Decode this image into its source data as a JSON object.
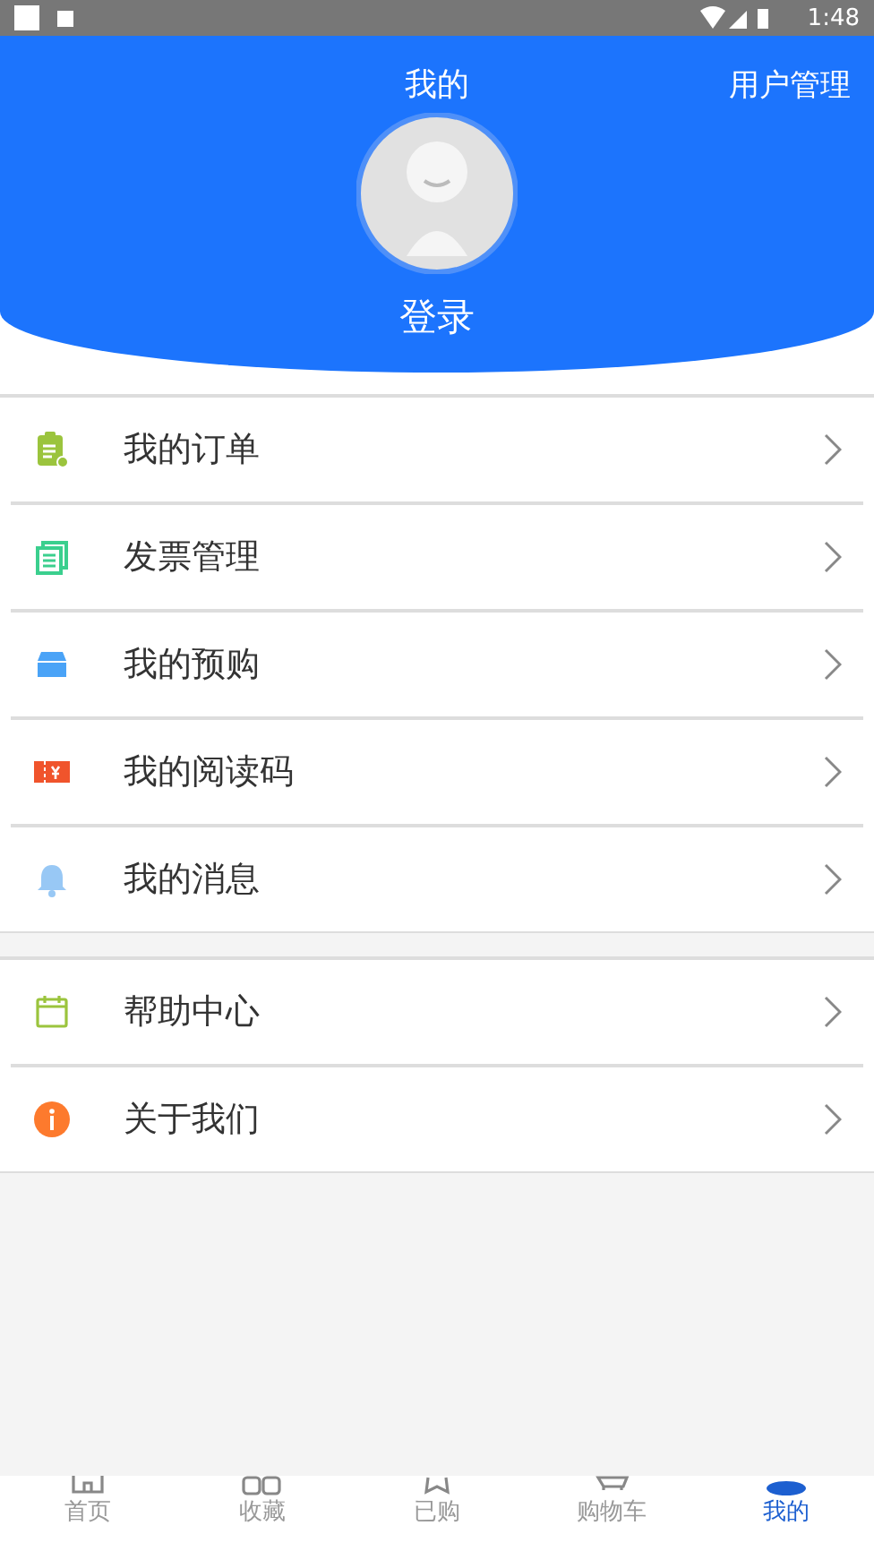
{
  "status_bar": {
    "time": "1:48"
  },
  "header": {
    "title": "我的",
    "action": "用户管理",
    "login": "登录"
  },
  "menu_groups": [
    {
      "items": [
        {
          "kind": "order",
          "label": "我的订单"
        },
        {
          "kind": "invoice",
          "label": "发票管理"
        },
        {
          "kind": "preorder",
          "label": "我的预购"
        },
        {
          "kind": "code",
          "label": "我的阅读码"
        },
        {
          "kind": "message",
          "label": "我的消息"
        }
      ]
    },
    {
      "items": [
        {
          "kind": "help",
          "label": "帮助中心"
        },
        {
          "kind": "about",
          "label": "关于我们"
        }
      ]
    }
  ],
  "tabs": [
    {
      "kind": "home",
      "label": "首页",
      "selected": false
    },
    {
      "kind": "favorites",
      "label": "收藏",
      "selected": false
    },
    {
      "kind": "bought",
      "label": "已购",
      "selected": false
    },
    {
      "kind": "cart",
      "label": "购物车",
      "selected": false
    },
    {
      "kind": "me",
      "label": "我的",
      "selected": true
    }
  ]
}
